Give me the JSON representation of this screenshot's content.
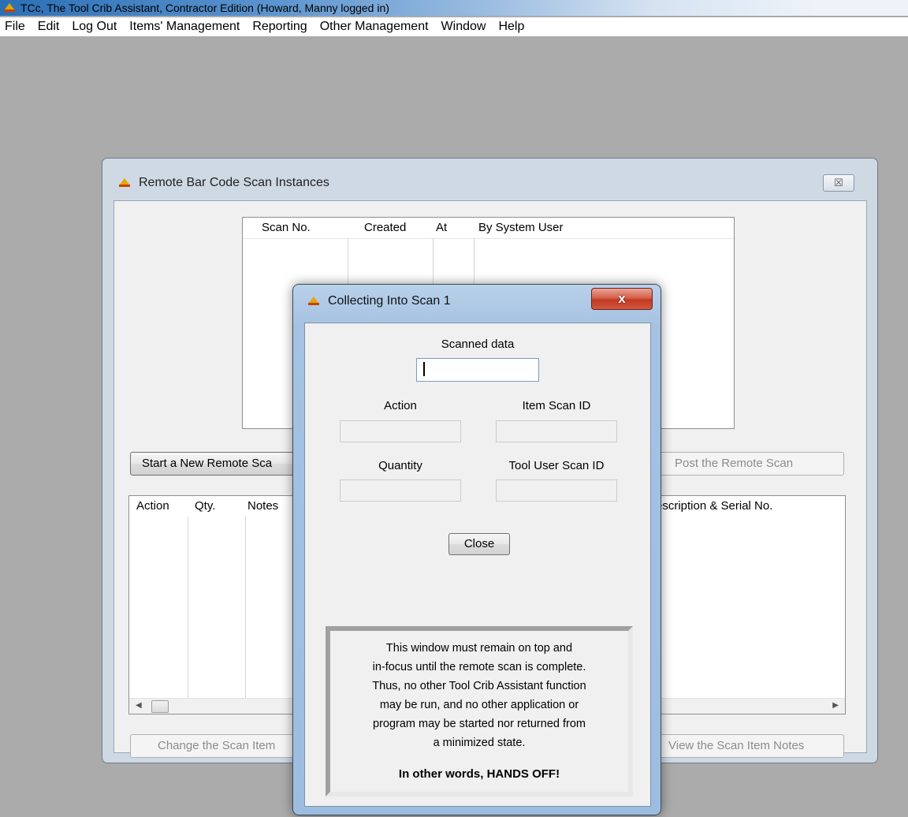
{
  "app": {
    "title": "TCc, The Tool Crib Assistant, Contractor Edition (Howard, Manny logged in)"
  },
  "menu": {
    "items": [
      "File",
      "Edit",
      "Log Out",
      "Items' Management",
      "Reporting",
      "Other Management",
      "Window",
      "Help"
    ]
  },
  "scan_window": {
    "title": "Remote Bar Code Scan Instances",
    "close_glyph": "☒",
    "scan_list": {
      "columns": [
        "Scan No.",
        "Created",
        "At",
        "By System User"
      ]
    },
    "buttons": {
      "start_new": "Start a New Remote Sca",
      "post": "Post the Remote Scan",
      "change_item": "Change the Scan Item",
      "view_notes": "View the Scan Item Notes"
    },
    "item_list": {
      "columns": [
        "Action",
        "Qty.",
        "Notes",
        "escription & Serial No."
      ]
    }
  },
  "dialog": {
    "title": "Collecting Into Scan 1",
    "close_glyph": "x",
    "scanned_data_label": "Scanned data",
    "scanned_data_value": "",
    "action_label": "Action",
    "action_value": "",
    "item_scan_id_label": "Item Scan ID",
    "item_scan_id_value": "",
    "quantity_label": "Quantity",
    "quantity_value": "",
    "tool_user_scan_id_label": "Tool User Scan ID",
    "tool_user_scan_id_value": "",
    "close_button": "Close",
    "notice_lines": [
      "This window must remain on top and",
      "in-focus until the remote scan is complete.",
      "Thus, no other Tool Crib Assistant function",
      "may be run, and no other application or",
      "program may be started nor returned from",
      "a minimized state."
    ],
    "notice_emphasis": "In other words, HANDS OFF!"
  }
}
